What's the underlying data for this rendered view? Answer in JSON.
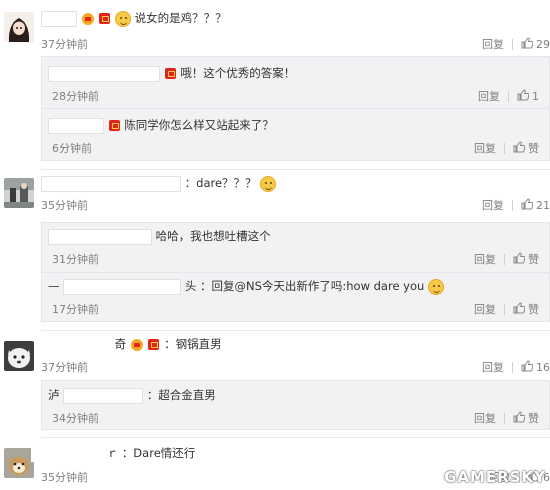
{
  "comments": [
    {
      "text": "说女的是鸡？？？",
      "time": "37分钟前",
      "reply_label": "回复",
      "likes": "29",
      "replies": [
        {
          "text": "哦！这个优秀的答案！",
          "time": "28分钟前",
          "reply_label": "回复",
          "likes": "1"
        },
        {
          "text": "陈同学你怎么样又站起来了？",
          "time": "6分钟前",
          "reply_label": "回复",
          "likes": "赞"
        }
      ]
    },
    {
      "text": "：dare？？？",
      "time": "35分钟前",
      "reply_label": "回复",
      "likes": "21",
      "replies": [
        {
          "text": "哈哈，我也想吐槽这个",
          "time": "31分钟前",
          "reply_label": "回复",
          "likes": "赞"
        },
        {
          "prefix": "—",
          "suffix": "头",
          "text": "：回复@NS今天出新作了吗:how dare you",
          "time": "17分钟前",
          "reply_label": "回复",
          "likes": "赞"
        }
      ]
    },
    {
      "name_suffix": "奇",
      "text": "：钢锅直男",
      "time": "37分钟前",
      "reply_label": "回复",
      "likes": "16",
      "replies": [
        {
          "prefix": "泸",
          "text": "：超合金直男",
          "time": "34分钟前",
          "reply_label": "回复",
          "likes": "赞"
        }
      ]
    },
    {
      "name_suffix": "ｒ",
      "text": "：Dare情还行",
      "time": "35分钟前",
      "reply_label": "回复",
      "likes": "6"
    }
  ],
  "watermark": "GAMERSKY",
  "colors": {
    "meta": "#808080",
    "reply_bg": "#f2f2f5",
    "badge_red": "#e2231a"
  }
}
